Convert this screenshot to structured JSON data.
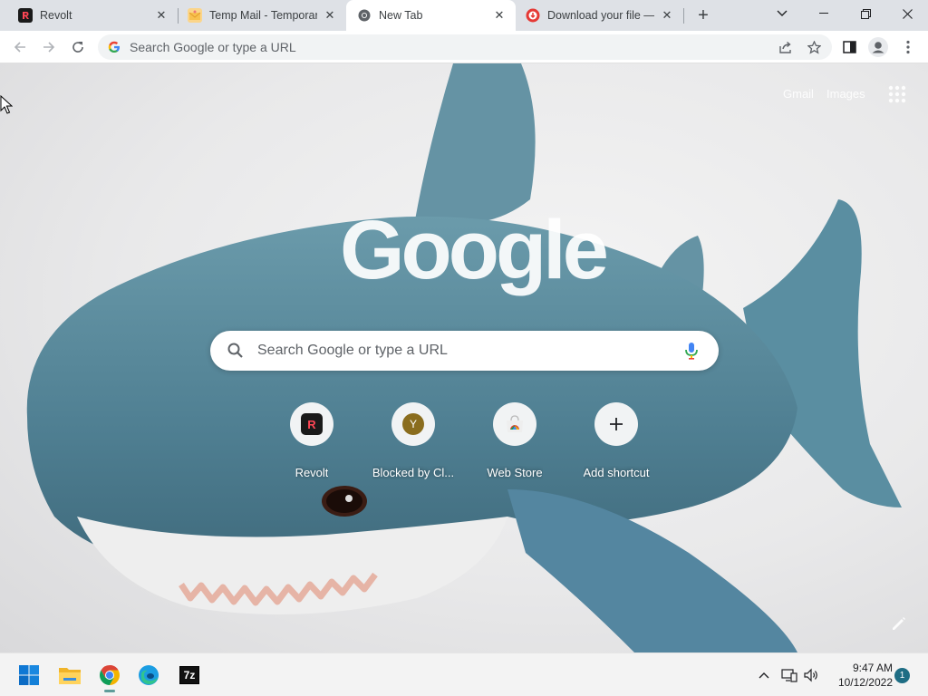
{
  "browser": {
    "tabs": [
      {
        "title": "Revolt",
        "favicon": "revolt-icon",
        "active": false
      },
      {
        "title": "Temp Mail - Temporary",
        "favicon": "temp-mail-icon",
        "active": false
      },
      {
        "title": "New Tab",
        "favicon": "chrome-icon",
        "active": true
      },
      {
        "title": "Download your file — ",
        "favicon": "download-site-icon",
        "active": false
      }
    ],
    "new_tab_label": "+",
    "omnibox": {
      "placeholder": "Search Google or type a URL"
    }
  },
  "ntp": {
    "links": {
      "gmail": "Gmail",
      "images": "Images"
    },
    "logo": "Google",
    "search_placeholder": "Search Google or type a URL",
    "shortcuts": [
      {
        "label": "Revolt",
        "icon": "revolt-icon",
        "initial": "R"
      },
      {
        "label": "Blocked by Cl...",
        "icon": "letter-avatar-icon",
        "initial": "Y"
      },
      {
        "label": "Web Store",
        "icon": "web-store-icon",
        "initial": ""
      },
      {
        "label": "Add shortcut",
        "icon": "plus-icon",
        "initial": "+"
      }
    ]
  },
  "taskbar": {
    "apps": [
      {
        "name": "start",
        "icon": "windows-start-icon"
      },
      {
        "name": "file-explorer",
        "icon": "folder-icon"
      },
      {
        "name": "chrome",
        "icon": "chrome-icon",
        "running": true
      },
      {
        "name": "edge",
        "icon": "edge-icon"
      },
      {
        "name": "7zip",
        "icon": "seven-zip-icon",
        "label": "7z"
      }
    ],
    "clock": {
      "time": "9:47 AM",
      "date": "10/12/2022"
    },
    "notification_count": "1"
  },
  "colors": {
    "revolt": "#ff4655",
    "chrome_red": "#db4437",
    "chrome_green": "#0f9d58",
    "chrome_yellow": "#f4b400",
    "chrome_blue": "#4285f4",
    "shark_blue": "#5f8fa0"
  }
}
